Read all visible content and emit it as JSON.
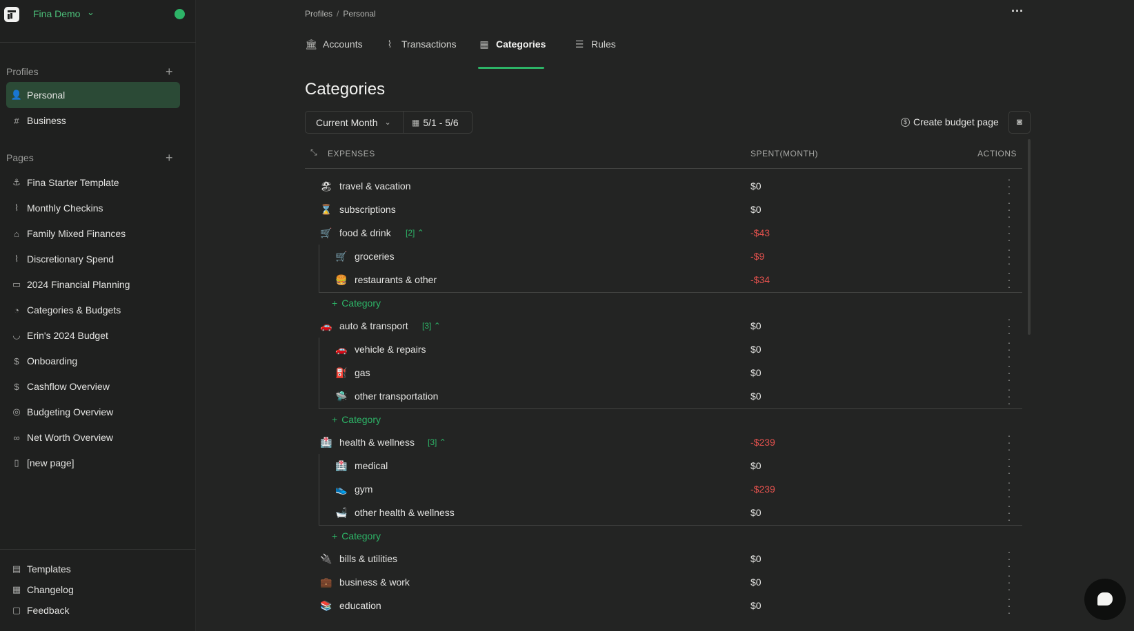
{
  "workspace": {
    "name": "Fina Demo",
    "status_color": "#2db467"
  },
  "sidebar": {
    "profiles_label": "Profiles",
    "profiles": [
      {
        "label": "Personal",
        "icon": "user-icon",
        "glyph": "👤",
        "active": true
      },
      {
        "label": "Business",
        "icon": "hash-icon",
        "glyph": "#",
        "active": false
      }
    ],
    "pages_label": "Pages",
    "pages": [
      {
        "label": "Fina Starter Template",
        "icon": "anchor-icon",
        "glyph": "⚓"
      },
      {
        "label": "Monthly Checkins",
        "icon": "activity-icon",
        "glyph": "⌇"
      },
      {
        "label": "Family Mixed Finances",
        "icon": "home-icon",
        "glyph": "⌂"
      },
      {
        "label": "Discretionary Spend",
        "icon": "activity-icon",
        "glyph": "⌇"
      },
      {
        "label": "2024 Financial Planning",
        "icon": "clipboard-icon",
        "glyph": "▭"
      },
      {
        "label": "Categories & Budgets",
        "icon": "shapes-icon",
        "glyph": "◔"
      },
      {
        "label": "Erin's 2024 Budget",
        "icon": "apple-icon",
        "glyph": "◡"
      },
      {
        "label": "Onboarding",
        "icon": "dollar-icon",
        "glyph": "$"
      },
      {
        "label": "Cashflow Overview",
        "icon": "dollar-icon",
        "glyph": "$"
      },
      {
        "label": "Budgeting Overview",
        "icon": "target-icon",
        "glyph": "◎"
      },
      {
        "label": "Net Worth Overview",
        "icon": "glasses-icon",
        "glyph": "∞"
      },
      {
        "label": "[new page]",
        "icon": "file-icon",
        "glyph": "▯"
      }
    ],
    "footer": [
      {
        "label": "Templates",
        "icon": "templates-icon",
        "glyph": "▤"
      },
      {
        "label": "Changelog",
        "icon": "changelog-icon",
        "glyph": "▦"
      },
      {
        "label": "Feedback",
        "icon": "feedback-icon",
        "glyph": "▢"
      }
    ]
  },
  "breadcrumb": {
    "root": "Profiles",
    "current": "Personal"
  },
  "tabs": [
    {
      "label": "Accounts",
      "icon": "bank-icon",
      "glyph": "🏛",
      "active": false
    },
    {
      "label": "Transactions",
      "icon": "activity-icon",
      "glyph": "⌇",
      "active": false
    },
    {
      "label": "Categories",
      "icon": "grid-icon",
      "glyph": "▦",
      "active": true
    },
    {
      "label": "Rules",
      "icon": "checklist-icon",
      "glyph": "☰",
      "active": false
    }
  ],
  "page_title": "Categories",
  "toolbar": {
    "period": "Current Month",
    "date_range": "5/1 - 5/6",
    "create_budget_label": "Create budget page"
  },
  "table": {
    "col_expenses": "EXPENSES",
    "col_spent": "SPENT(MONTH)",
    "col_actions": "ACTIONS",
    "add_category_label": "Category",
    "rows": [
      {
        "type": "cat",
        "emoji": "🏖",
        "label": "travel & vacation",
        "amount": "$0",
        "negative": false
      },
      {
        "type": "cat",
        "emoji": "⌛",
        "label": "subscriptions",
        "amount": "$0",
        "negative": false
      },
      {
        "type": "cat",
        "emoji": "🛒",
        "label": "food & drink",
        "count": "[2]",
        "amount": "-$43",
        "negative": true
      },
      {
        "type": "sub",
        "emoji": "🛒",
        "label": "groceries",
        "amount": "-$9",
        "negative": true
      },
      {
        "type": "sub",
        "emoji": "🍔",
        "label": "restaurants & other",
        "amount": "-$34",
        "negative": true
      },
      {
        "type": "add"
      },
      {
        "type": "cat",
        "emoji": "🚗",
        "label": "auto & transport",
        "count": "[3]",
        "amount": "$0",
        "negative": false
      },
      {
        "type": "sub",
        "emoji": "🚗",
        "label": "vehicle & repairs",
        "amount": "$0",
        "negative": false
      },
      {
        "type": "sub",
        "emoji": "⛽",
        "label": "gas",
        "amount": "$0",
        "negative": false
      },
      {
        "type": "sub",
        "emoji": "🛸",
        "label": "other transportation",
        "amount": "$0",
        "negative": false
      },
      {
        "type": "add"
      },
      {
        "type": "cat",
        "emoji": "🏥",
        "label": "health & wellness",
        "count": "[3]",
        "amount": "-$239",
        "negative": true
      },
      {
        "type": "sub",
        "emoji": "🏥",
        "label": "medical",
        "amount": "$0",
        "negative": false
      },
      {
        "type": "sub",
        "emoji": "👟",
        "label": "gym",
        "amount": "-$239",
        "negative": true
      },
      {
        "type": "sub",
        "emoji": "🛁",
        "label": "other health & wellness",
        "amount": "$0",
        "negative": false
      },
      {
        "type": "add"
      },
      {
        "type": "cat",
        "emoji": "🔌",
        "label": "bills & utilities",
        "amount": "$0",
        "negative": false
      },
      {
        "type": "cat",
        "emoji": "💼",
        "label": "business & work",
        "amount": "$0",
        "negative": false
      },
      {
        "type": "cat",
        "emoji": "📚",
        "label": "education",
        "amount": "$0",
        "negative": false
      }
    ]
  },
  "colors": {
    "accent": "#2db467",
    "negative": "#e0514d",
    "active_nav": "#2b4a36"
  }
}
